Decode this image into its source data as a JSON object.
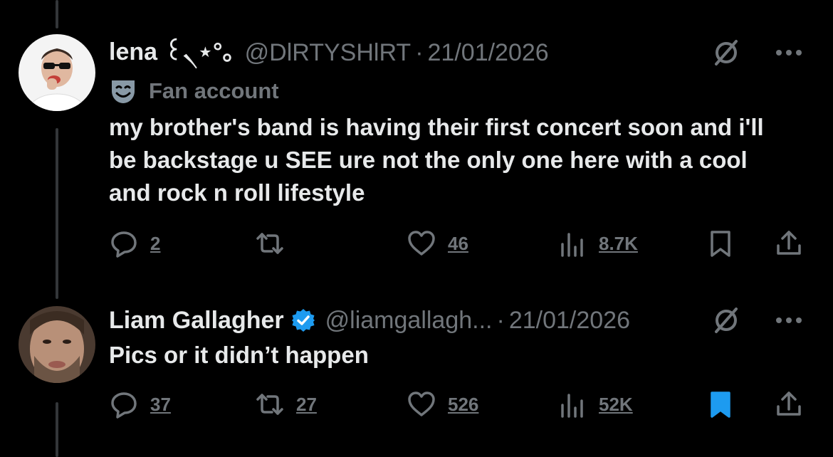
{
  "tweets": [
    {
      "display_name": "lena ꒰৲⋆°｡",
      "handle": "@DlRTYSHlRT",
      "separator": "·",
      "date": "21/01/2026",
      "label": "Fan account",
      "label_icon": "theater-masks-icon",
      "text": "my brother's band is having their first concert soon and i'll be backstage u SEE ure not the only one here with a cool and rock n roll lifestyle",
      "replies": "2",
      "retweets": "",
      "likes": "46",
      "views": "8.7K",
      "bookmarked": false,
      "verified": false
    },
    {
      "display_name": "Liam Gallagher",
      "handle": "@liamgallagh...",
      "separator": "·",
      "date": "21/01/2026",
      "text": "Pics or it didn’t happen",
      "replies": "37",
      "retweets": "27",
      "likes": "526",
      "views": "52K",
      "bookmarked": true,
      "verified": true
    }
  ],
  "colors": {
    "background": "#000000",
    "text_primary": "#e7e9ea",
    "text_secondary": "#71767b",
    "accent": "#1d9bf0",
    "thread_line": "#333639"
  }
}
